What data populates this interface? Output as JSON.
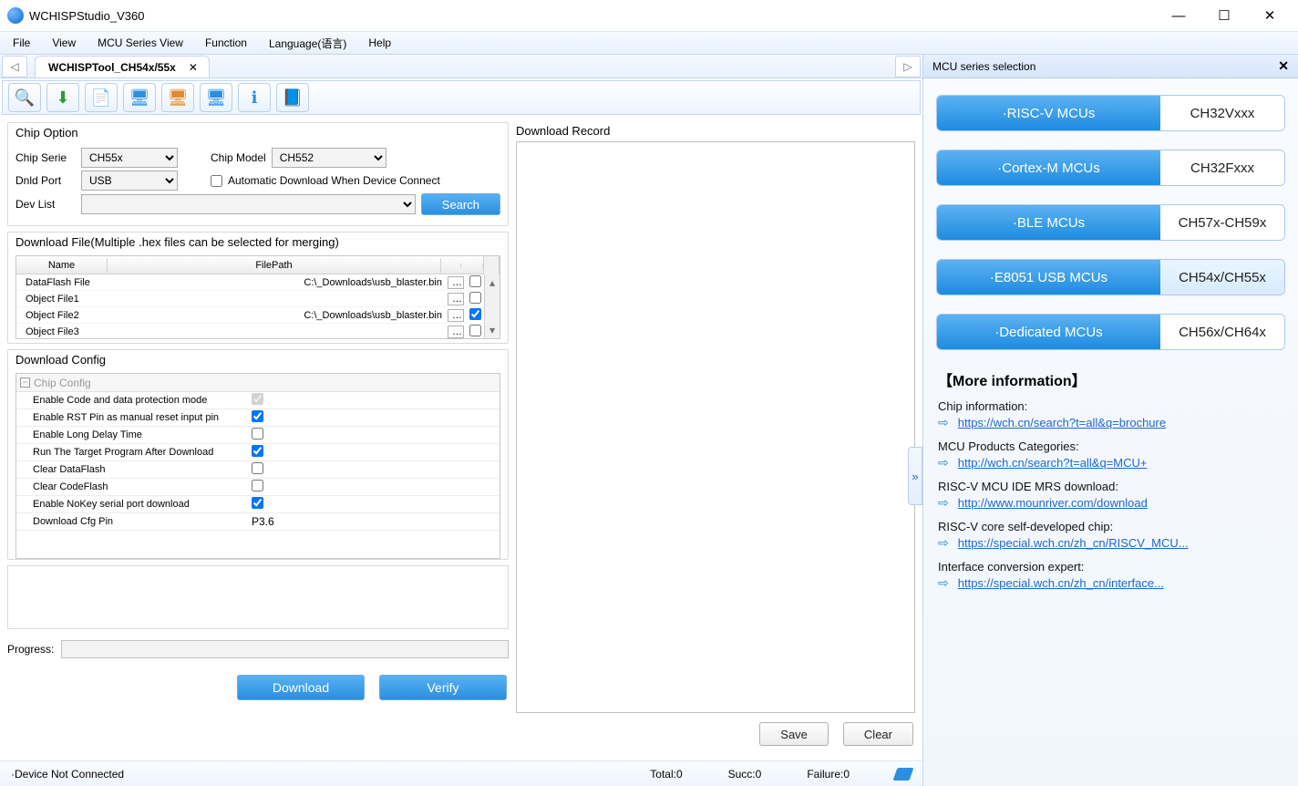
{
  "window": {
    "title": "WCHISPStudio_V360"
  },
  "menu": [
    "File",
    "View",
    "MCU Series View",
    "Function",
    "Language(语言)",
    "Help"
  ],
  "tab": {
    "label": "WCHISPTool_CH54x/55x"
  },
  "chipOption": {
    "title": "Chip Option",
    "serieLabel": "Chip Serie",
    "serie": "CH55x",
    "modelLabel": "Chip Model",
    "model": "CH552",
    "portLabel": "Dnld Port",
    "port": "USB",
    "autoLabel": "Automatic Download When Device Connect",
    "devLabel": "Dev List",
    "searchLabel": "Search"
  },
  "dlfile": {
    "title": "Download File(Multiple .hex files can be selected for merging)",
    "cols": {
      "name": "Name",
      "path": "FilePath"
    },
    "rows": [
      {
        "name": "DataFlash File",
        "path": "C:\\_Downloads\\usb_blaster.bin",
        "checked": false
      },
      {
        "name": "Object File1",
        "path": "",
        "checked": false
      },
      {
        "name": "Object File2",
        "path": "C:\\_Downloads\\usb_blaster.bin",
        "checked": true
      },
      {
        "name": "Object File3",
        "path": "",
        "checked": false
      }
    ]
  },
  "dlcfg": {
    "title": "Download Config",
    "group": "Chip Config",
    "rows": [
      {
        "label": "Enable Code and data protection mode",
        "checked": true,
        "disabled": true
      },
      {
        "label": "Enable RST Pin as manual reset input pin",
        "checked": true
      },
      {
        "label": "Enable Long Delay Time",
        "checked": false
      },
      {
        "label": "Run The Target Program After Download",
        "checked": true
      },
      {
        "label": "Clear DataFlash",
        "checked": false
      },
      {
        "label": "Clear CodeFlash",
        "checked": false
      },
      {
        "label": "Enable NoKey serial port download",
        "checked": true
      },
      {
        "label": "Download Cfg Pin",
        "value": "P3.6"
      }
    ]
  },
  "progressLabel": "Progress:",
  "actions": {
    "download": "Download",
    "verify": "Verify"
  },
  "record": {
    "title": "Download Record",
    "save": "Save",
    "clear": "Clear"
  },
  "status": {
    "device": "·Device  Not Connected",
    "total": "Total:0",
    "succ": "Succ:0",
    "fail": "Failure:0"
  },
  "rightPanel": {
    "title": "MCU series selection",
    "items": [
      {
        "l": "·RISC-V MCUs",
        "r": "CH32Vxxx"
      },
      {
        "l": "·Cortex-M MCUs",
        "r": "CH32Fxxx"
      },
      {
        "l": "·BLE MCUs",
        "r": "CH57x-CH59x"
      },
      {
        "l": "·E8051 USB MCUs",
        "r": "CH54x/CH55x",
        "sel": true
      },
      {
        "l": "·Dedicated MCUs",
        "r": "CH56x/CH64x"
      }
    ],
    "moreTitle": "【More information】",
    "links": [
      {
        "t": "Chip information:",
        "u": "https://wch.cn/search?t=all&q=brochure"
      },
      {
        "t": "MCU Products Categories:",
        "u": "http://wch.cn/search?t=all&q=MCU+"
      },
      {
        "t": "RISC-V MCU IDE MRS download:",
        "u": "http://www.mounriver.com/download"
      },
      {
        "t": "RISC-V core self-developed chip:",
        "u": "https://special.wch.cn/zh_cn/RISCV_MCU..."
      },
      {
        "t": "Interface conversion expert:",
        "u": "https://special.wch.cn/zh_cn/interface..."
      }
    ]
  }
}
